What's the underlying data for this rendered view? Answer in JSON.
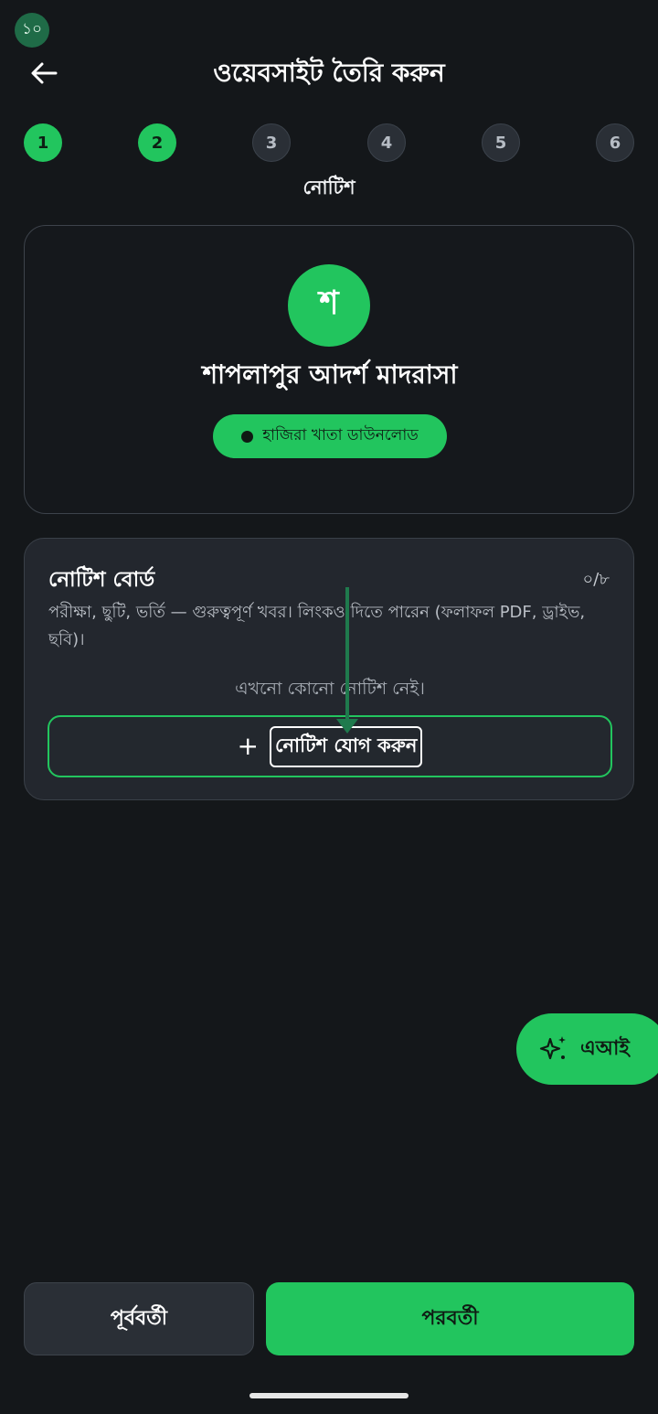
{
  "status": {
    "badge": "১০"
  },
  "header": {
    "title": "ওয়েবসাইট তৈরি করুন",
    "back_icon": "arrow-left-icon"
  },
  "stepper": {
    "steps": [
      {
        "label": "1",
        "state": "done"
      },
      {
        "label": "2",
        "state": "done"
      },
      {
        "label": "3",
        "state": "todo"
      },
      {
        "label": "4",
        "state": "todo"
      },
      {
        "label": "5",
        "state": "todo"
      },
      {
        "label": "6",
        "state": "todo"
      }
    ],
    "current_caption": "নোটিশ"
  },
  "preview": {
    "avatar_letter": "শ",
    "school_name": "শাপলাপুর আদর্শ মাদরাসা",
    "notice_chip": "হাজিরা খাতা ডাউনলোড"
  },
  "notice_board": {
    "title": "নোটিশ বোর্ড",
    "count": "০/৮",
    "description": "পরীক্ষা, ছুটি, ভর্তি — গুরুত্বপূর্ণ খবর। লিংকও দিতে পারেন (ফলাফল PDF, ড্রাইভ, ছবি)।",
    "empty_text": "এখনো কোনো নোটিশ নেই।",
    "add_button": "নোটিশ যোগ করুন",
    "add_icon": "+"
  },
  "ai_fab": {
    "label": "এআই",
    "icon": "sparkles-icon"
  },
  "footer": {
    "prev_label": "পূর্ববর্তী",
    "next_label": "পরবর্তী"
  },
  "colors": {
    "accent": "#22c55e",
    "background": "#14171a",
    "card": "#23272e"
  }
}
